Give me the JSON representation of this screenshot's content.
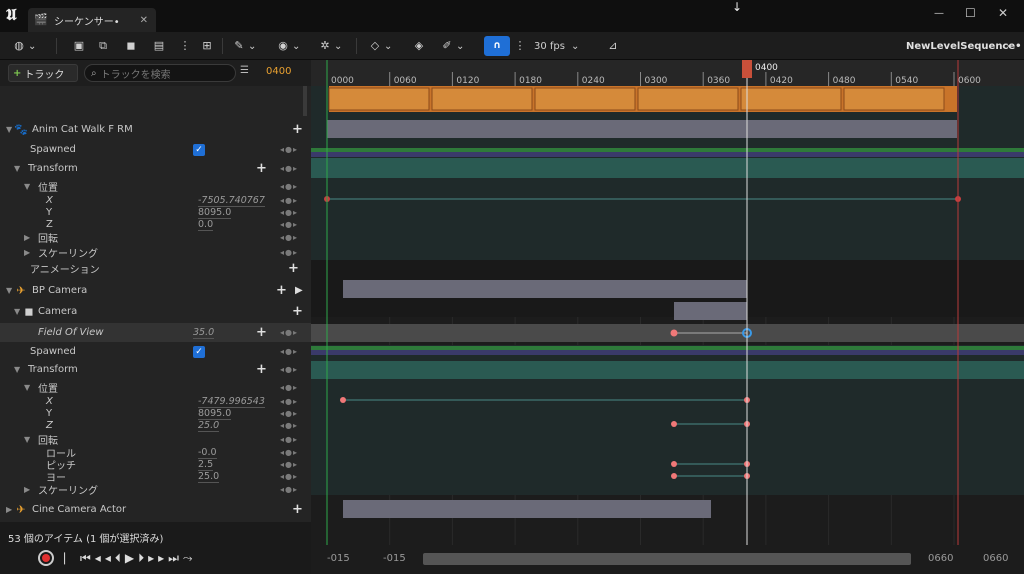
{
  "window": {
    "tab_title": "シーケンサー•",
    "seq_name": "NewLevelSequence•"
  },
  "toolbar": {
    "fps": "30 fps"
  },
  "left": {
    "add_track": "トラック",
    "search_placeholder": "トラックを検索",
    "frame": "0400",
    "rows": [
      {
        "label": "Anim Cat Walk F RM"
      },
      {
        "label": "Spawned"
      },
      {
        "label": "Transform"
      },
      {
        "label": "位置"
      },
      {
        "label": "X",
        "value": "-7505.740767"
      },
      {
        "label": "Y",
        "value": "8095.0"
      },
      {
        "label": "Z",
        "value": "0.0"
      },
      {
        "label": "回転"
      },
      {
        "label": "スケーリング"
      },
      {
        "label": "アニメーション"
      },
      {
        "label": "BP Camera"
      },
      {
        "label": "Camera"
      },
      {
        "label": "Field Of View",
        "value": "35.0"
      },
      {
        "label": "Spawned"
      },
      {
        "label": "Transform"
      },
      {
        "label": "位置"
      },
      {
        "label": "X",
        "value": "-7479.996543"
      },
      {
        "label": "Y",
        "value": "8095.0"
      },
      {
        "label": "Z",
        "value": "25.0"
      },
      {
        "label": "回転"
      },
      {
        "label": "ロール",
        "value": "-0.0"
      },
      {
        "label": "ピッチ",
        "value": "2.5"
      },
      {
        "label": "ヨー",
        "value": "25.0"
      },
      {
        "label": "スケーリング"
      },
      {
        "label": "Cine Camera Actor"
      }
    ],
    "status": "53 個のアイテム (1 個が選択済み)"
  },
  "timeline": {
    "playhead": "0400",
    "ticks": [
      "0000",
      "0060",
      "0120",
      "0180",
      "0240",
      "0300",
      "0360",
      "0420",
      "0480",
      "0540",
      "0600"
    ],
    "range_start": "-015",
    "range_start2": "-015",
    "range_end": "0660",
    "range_end2": "0660"
  },
  "colors": {
    "accent": "#1f6fd6",
    "key": "#f07878",
    "playhead": "#c8503a"
  }
}
